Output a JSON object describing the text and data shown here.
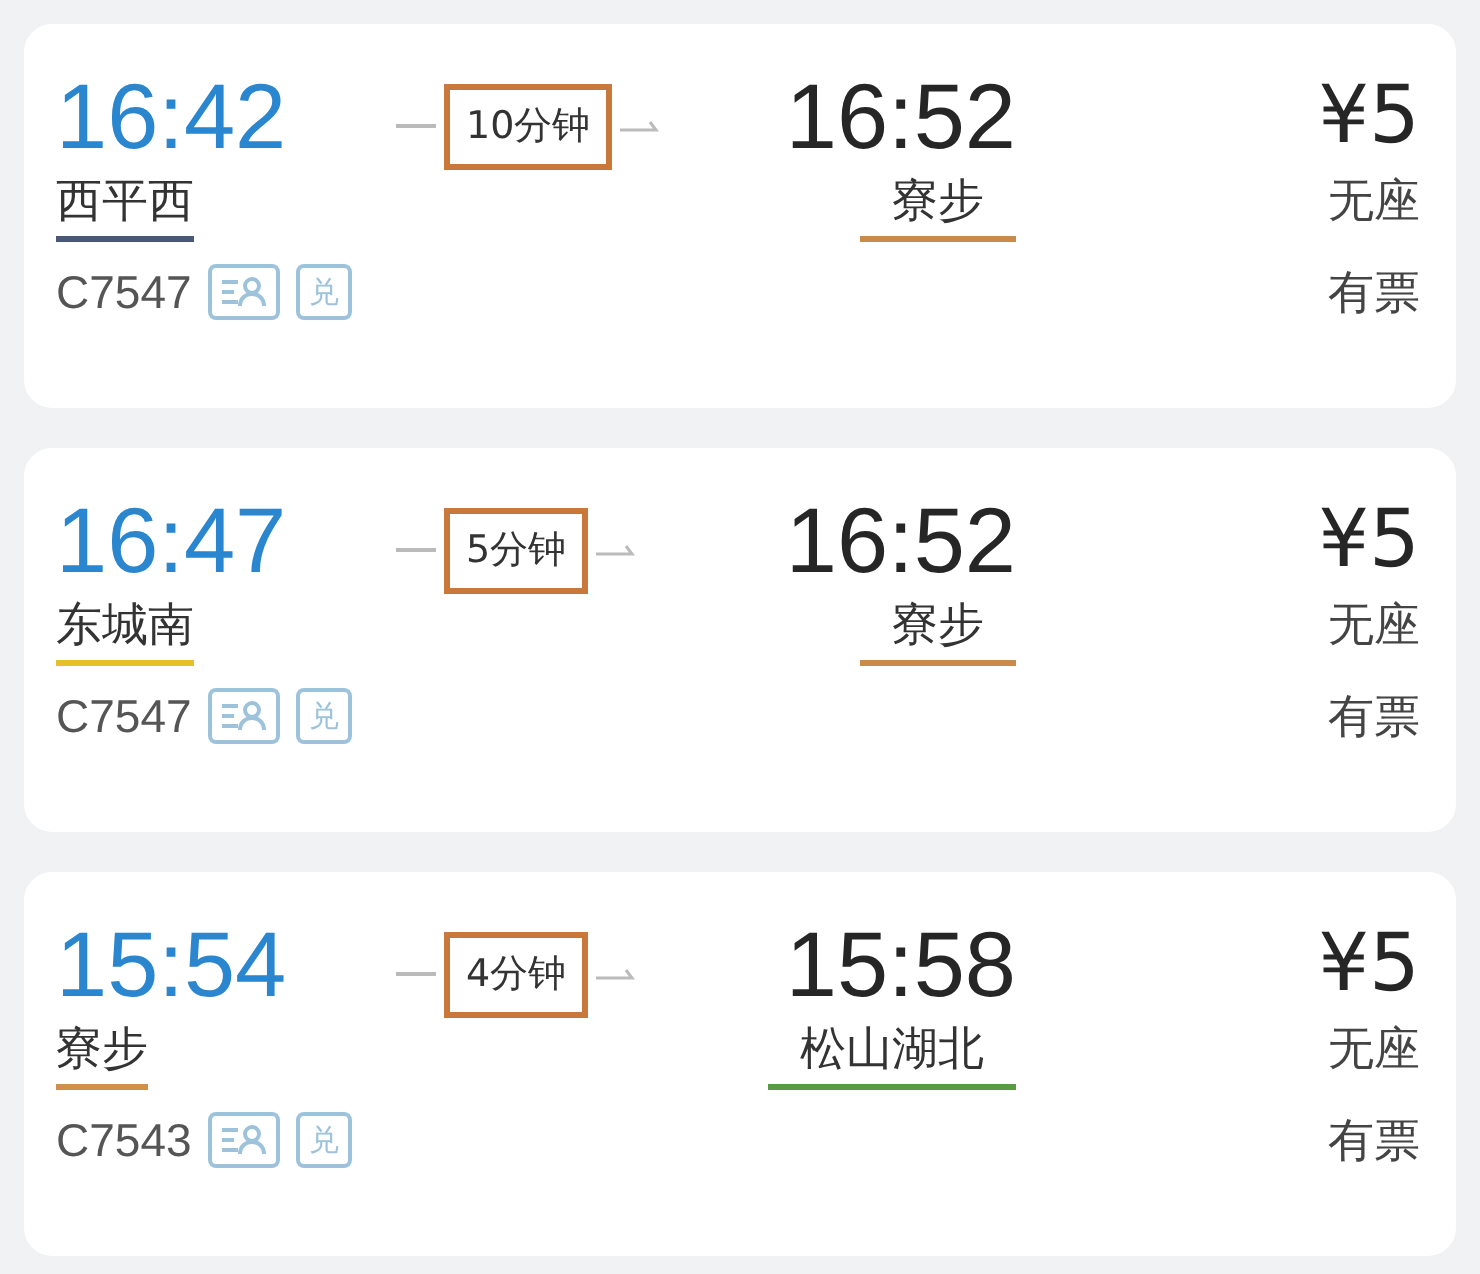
{
  "trains": [
    {
      "depart_time": "16:42",
      "duration": "10分钟",
      "arrive_time": "16:52",
      "depart_station": {
        "name": "西平西",
        "color": "#4a5878"
      },
      "arrive_station": {
        "name": "寮步",
        "color": "#c98a4a"
      },
      "train_no": "C7547",
      "badge": "兑",
      "price": "¥5",
      "seat": "无座",
      "availability": "有票"
    },
    {
      "depart_time": "16:47",
      "duration": "5分钟",
      "arrive_time": "16:52",
      "depart_station": {
        "name": "东城南",
        "color": "#e6c02a"
      },
      "arrive_station": {
        "name": "寮步",
        "color": "#c98a4a"
      },
      "train_no": "C7547",
      "badge": "兑",
      "price": "¥5",
      "seat": "无座",
      "availability": "有票"
    },
    {
      "depart_time": "15:54",
      "duration": "4分钟",
      "arrive_time": "15:58",
      "depart_station": {
        "name": "寮步",
        "color": "#d0904a"
      },
      "arrive_station": {
        "name": "松山湖北",
        "color": "#5a9a44"
      },
      "train_no": "C7543",
      "badge": "兑",
      "price": "¥5",
      "seat": "无座",
      "availability": "有票"
    }
  ]
}
